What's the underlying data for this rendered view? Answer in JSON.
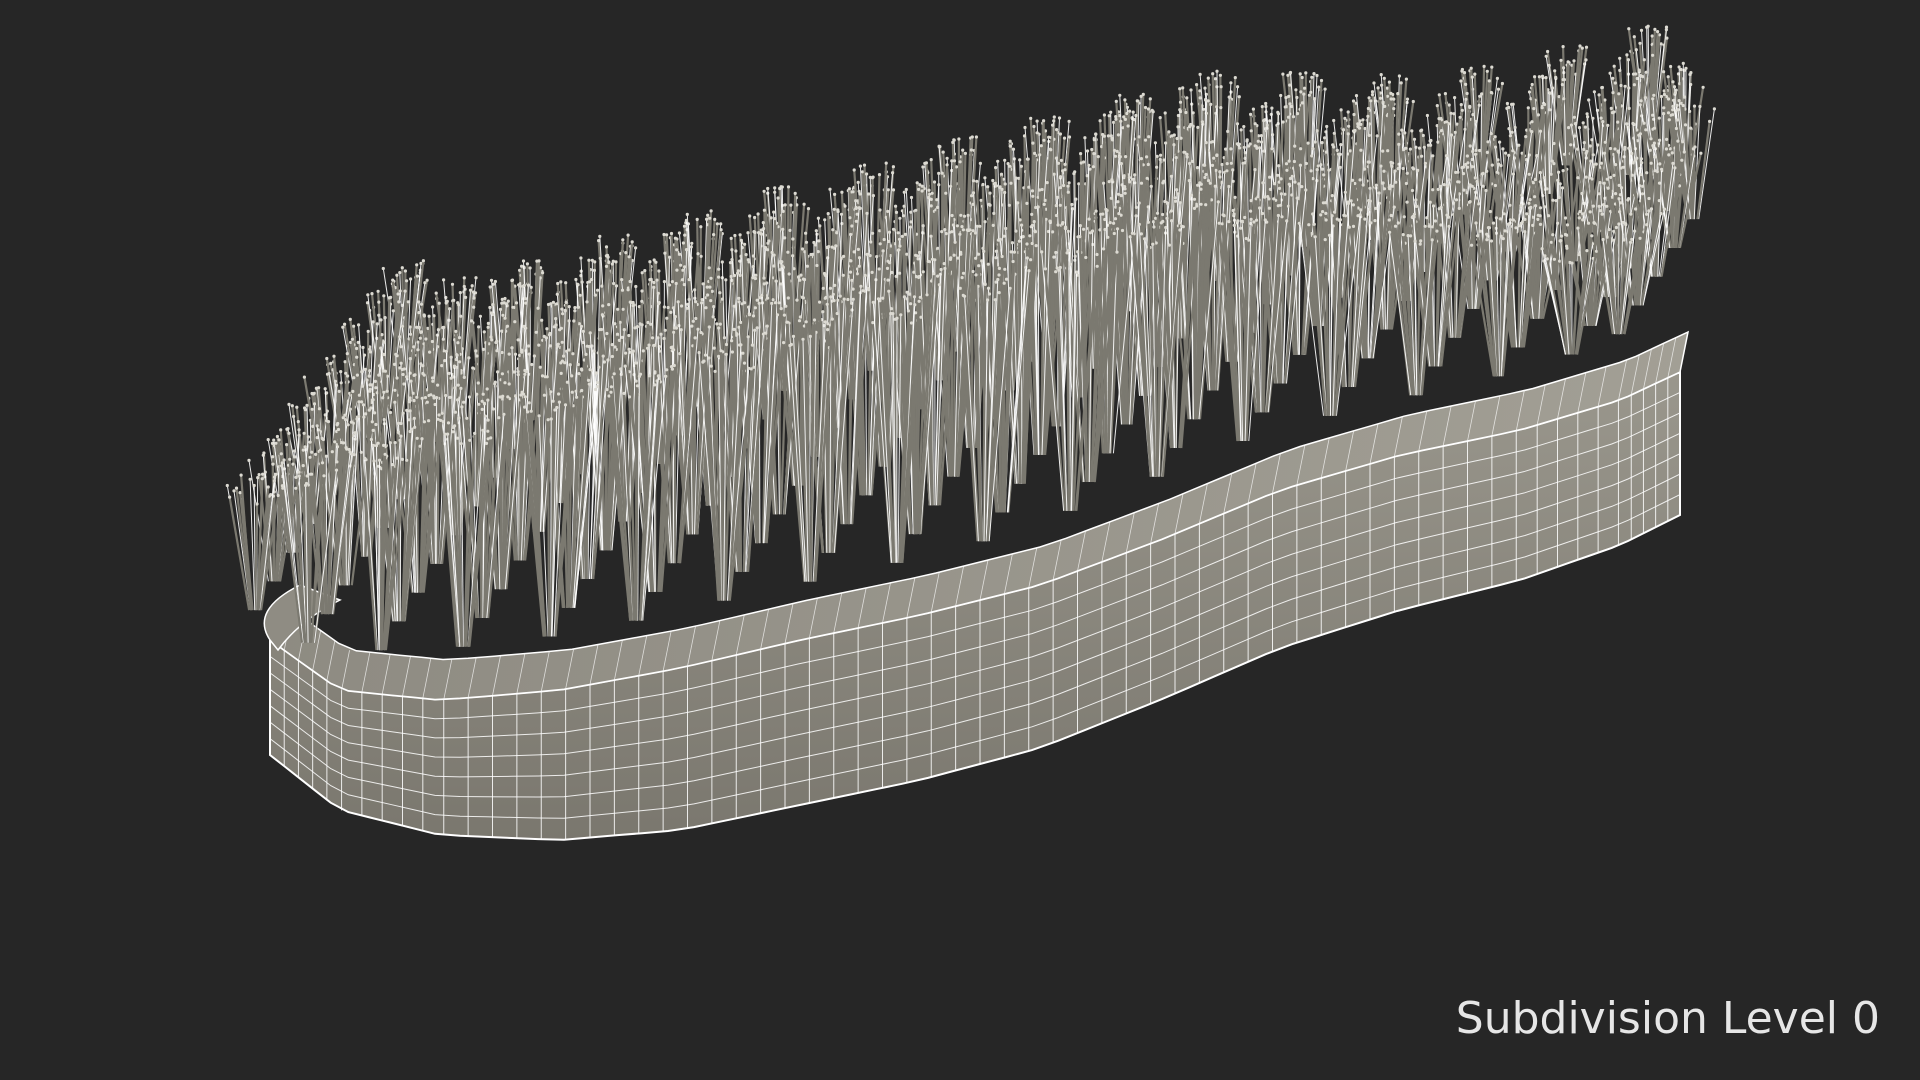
{
  "viewport": {
    "background_color": "#262626",
    "label": "Subdivision Level 0"
  },
  "model": {
    "object": "scrub-brush",
    "render_mode": "wireframe-on-shaded",
    "base_color": "#8c8a80",
    "wire_color": "#ffffff",
    "bristle_color": "#7b7970"
  }
}
